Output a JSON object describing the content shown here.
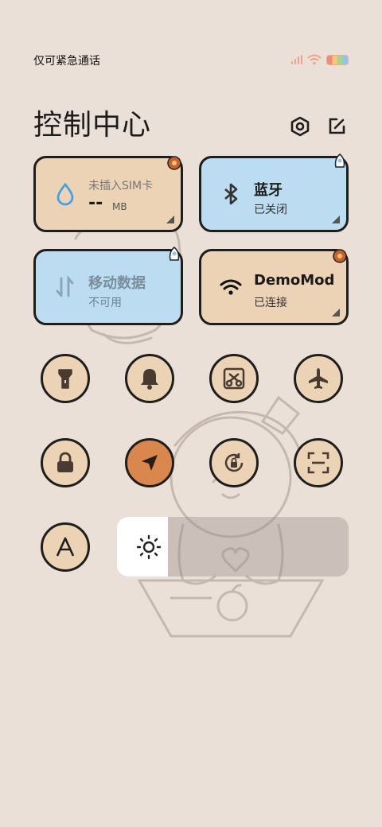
{
  "status_bar": {
    "carrier_text": "仅可紧急通话",
    "icons": [
      "signal-icon",
      "wifi-icon",
      "battery-icon"
    ]
  },
  "header": {
    "title": "控制中心",
    "buttons": [
      "settings-icon",
      "edit-icon"
    ]
  },
  "tiles": [
    {
      "id": "mobile-data-usage",
      "label": "未插入SIM卡",
      "value": "--",
      "unit": "MB",
      "icon": "water-drop-icon",
      "color": "#ecd3b5"
    },
    {
      "id": "bluetooth",
      "label": "蓝牙",
      "sub": "已关闭",
      "icon": "bluetooth-icon",
      "color": "#bcdcf1"
    },
    {
      "id": "mobile-data",
      "label": "移动数据",
      "sub": "不可用",
      "icon": "data-arrows-icon",
      "color": "#bcdcf1"
    },
    {
      "id": "wifi",
      "label": "DemoMod",
      "sub": "已连接",
      "icon": "wifi-icon",
      "color": "#ecd3b5"
    }
  ],
  "toggles": [
    {
      "name": "flashlight",
      "icon": "flashlight-icon",
      "active": false
    },
    {
      "name": "ring-mode",
      "icon": "bell-icon",
      "active": false
    },
    {
      "name": "screenshot",
      "icon": "scissors-icon",
      "active": false
    },
    {
      "name": "airplane-mode",
      "icon": "airplane-icon",
      "active": false
    },
    {
      "name": "lock-screen",
      "icon": "lock-icon",
      "active": false
    },
    {
      "name": "location",
      "icon": "location-arrow-icon",
      "active": true
    },
    {
      "name": "rotation-lock",
      "icon": "rotation-lock-icon",
      "active": false
    },
    {
      "name": "scanner",
      "icon": "scan-icon",
      "active": false
    },
    {
      "name": "font-size",
      "icon": "letter-a-icon",
      "active": false
    }
  ],
  "brightness": {
    "level": 0.22,
    "icon": "sun-icon"
  },
  "colors": {
    "tile_tan": "#ecd3b5",
    "tile_blue": "#bcdcf1",
    "active_orange": "#d9864f",
    "background": "#ebe0d8"
  }
}
